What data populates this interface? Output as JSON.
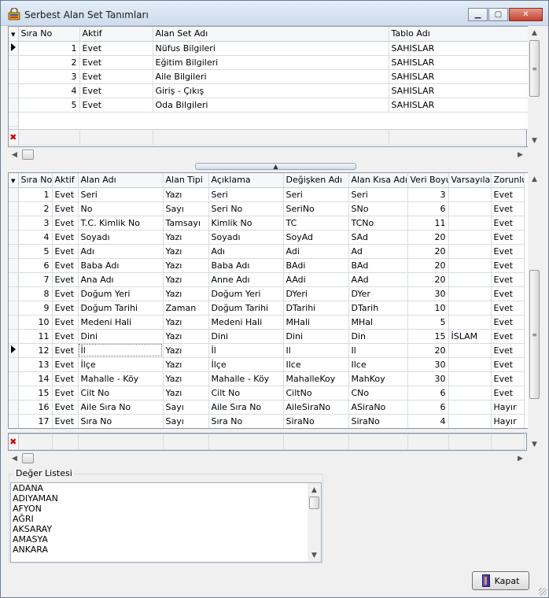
{
  "window": {
    "title": "Serbest Alan Set Tanımları"
  },
  "sets_grid": {
    "columns": [
      "Sıra No",
      "Aktif",
      "Alan Set Adı",
      "Tablo Adı"
    ],
    "rows": [
      {
        "sira": "1",
        "aktif": "Evet",
        "ad": "Nüfus Bilgileri",
        "tablo": "SAHISLAR"
      },
      {
        "sira": "2",
        "aktif": "Evet",
        "ad": "Eğitim Bilgileri",
        "tablo": "SAHISLAR"
      },
      {
        "sira": "3",
        "aktif": "Evet",
        "ad": "Aile Bilgileri",
        "tablo": "SAHISLAR"
      },
      {
        "sira": "4",
        "aktif": "Evet",
        "ad": "Giriş - Çıkış",
        "tablo": "SAHISLAR"
      },
      {
        "sira": "5",
        "aktif": "Evet",
        "ad": "Oda Bilgileri",
        "tablo": "SAHISLAR"
      }
    ]
  },
  "fields_grid": {
    "columns": [
      "Sıra No",
      "Aktif",
      "Alan Adı",
      "Alan Tipi",
      "Açıklama",
      "Değişken Adı",
      "Alan Kısa Adı",
      "Veri Boyu",
      "Varsayılan",
      "Zorunlu"
    ],
    "rows": [
      {
        "sira": "1",
        "aktif": "Evet",
        "ad": "Seri",
        "tip": "Yazı",
        "aciklama": "Seri",
        "degisken": "Seri",
        "kisa": "Seri",
        "boyu": "3",
        "varsayilan": "",
        "zorunlu": "Evet"
      },
      {
        "sira": "2",
        "aktif": "Evet",
        "ad": "No",
        "tip": "Sayı",
        "aciklama": "Seri No",
        "degisken": "SeriNo",
        "kisa": "SNo",
        "boyu": "6",
        "varsayilan": "",
        "zorunlu": "Evet"
      },
      {
        "sira": "3",
        "aktif": "Evet",
        "ad": "T.C. Kimlik No",
        "tip": "Tamsayı",
        "aciklama": "Kimlik No",
        "degisken": "TC",
        "kisa": "TCNo",
        "boyu": "11",
        "varsayilan": "",
        "zorunlu": "Evet"
      },
      {
        "sira": "4",
        "aktif": "Evet",
        "ad": "Soyadı",
        "tip": "Yazı",
        "aciklama": "Soyadı",
        "degisken": "SoyAd",
        "kisa": "SAd",
        "boyu": "20",
        "varsayilan": "",
        "zorunlu": "Evet"
      },
      {
        "sira": "5",
        "aktif": "Evet",
        "ad": "Adı",
        "tip": "Yazı",
        "aciklama": "Adı",
        "degisken": "Adi",
        "kisa": "Ad",
        "boyu": "20",
        "varsayilan": "",
        "zorunlu": "Evet"
      },
      {
        "sira": "6",
        "aktif": "Evet",
        "ad": "Baba Adı",
        "tip": "Yazı",
        "aciklama": "Baba Adı",
        "degisken": "BAdi",
        "kisa": "BAd",
        "boyu": "20",
        "varsayilan": "",
        "zorunlu": "Evet"
      },
      {
        "sira": "7",
        "aktif": "Evet",
        "ad": "Ana Adı",
        "tip": "Yazı",
        "aciklama": "Anne Adı",
        "degisken": "AAdi",
        "kisa": "AAd",
        "boyu": "20",
        "varsayilan": "",
        "zorunlu": "Evet"
      },
      {
        "sira": "8",
        "aktif": "Evet",
        "ad": "Doğum Yeri",
        "tip": "Yazı",
        "aciklama": "Doğum Yeri",
        "degisken": "DYeri",
        "kisa": "DYer",
        "boyu": "30",
        "varsayilan": "",
        "zorunlu": "Evet"
      },
      {
        "sira": "9",
        "aktif": "Evet",
        "ad": "Doğum Tarihi",
        "tip": "Zaman",
        "aciklama": "Doğum Tarihi",
        "degisken": "DTarihi",
        "kisa": "DTarih",
        "boyu": "10",
        "varsayilan": "",
        "zorunlu": "Evet"
      },
      {
        "sira": "10",
        "aktif": "Evet",
        "ad": "Medeni Hali",
        "tip": "Yazı",
        "aciklama": "Medeni Hali",
        "degisken": "MHali",
        "kisa": "MHal",
        "boyu": "5",
        "varsayilan": "",
        "zorunlu": "Evet"
      },
      {
        "sira": "11",
        "aktif": "Evet",
        "ad": "Dini",
        "tip": "Yazı",
        "aciklama": "Dini",
        "degisken": "Dini",
        "kisa": "Din",
        "boyu": "15",
        "varsayilan": "İSLAM",
        "zorunlu": "Evet"
      },
      {
        "sira": "12",
        "aktif": "Evet",
        "ad": "İl",
        "tip": "Yazı",
        "aciklama": "İl",
        "degisken": "Il",
        "kisa": "Il",
        "boyu": "20",
        "varsayilan": "",
        "zorunlu": "Evet"
      },
      {
        "sira": "13",
        "aktif": "Evet",
        "ad": "İlçe",
        "tip": "Yazı",
        "aciklama": "İlçe",
        "degisken": "Ilce",
        "kisa": "Ilce",
        "boyu": "30",
        "varsayilan": "",
        "zorunlu": "Evet"
      },
      {
        "sira": "14",
        "aktif": "Evet",
        "ad": "Mahalle - Köy",
        "tip": "Yazı",
        "aciklama": "Mahalle - Köy",
        "degisken": "MahalleKoy",
        "kisa": "MahKoy",
        "boyu": "30",
        "varsayilan": "",
        "zorunlu": "Evet"
      },
      {
        "sira": "15",
        "aktif": "Evet",
        "ad": "Cilt No",
        "tip": "Yazı",
        "aciklama": "Cilt No",
        "degisken": "CiltNo",
        "kisa": "CNo",
        "boyu": "6",
        "varsayilan": "",
        "zorunlu": "Evet"
      },
      {
        "sira": "16",
        "aktif": "Evet",
        "ad": "Aile Sıra No",
        "tip": "Sayı",
        "aciklama": "Aile Sıra No",
        "degisken": "AileSiraNo",
        "kisa": "ASiraNo",
        "boyu": "6",
        "varsayilan": "",
        "zorunlu": "Hayır"
      },
      {
        "sira": "17",
        "aktif": "Evet",
        "ad": "Sıra No",
        "tip": "Sayı",
        "aciklama": "Sıra No",
        "degisken": "SiraNo",
        "kisa": "SiraNo",
        "boyu": "4",
        "varsayilan": "",
        "zorunlu": "Hayır"
      }
    ]
  },
  "value_list": {
    "label": "Değer Listesi",
    "items": [
      "ADANA",
      "ADIYAMAN",
      "AFYON",
      "AĞRI",
      "AKSARAY",
      "AMASYA",
      "ANKARA"
    ]
  },
  "buttons": {
    "close": "Kapat"
  }
}
